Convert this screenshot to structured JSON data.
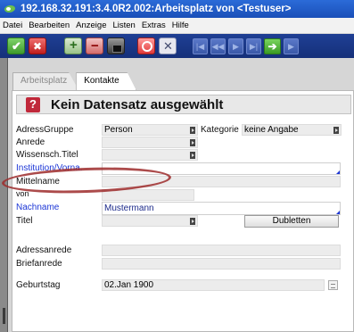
{
  "window": {
    "title": "192.168.32.191:3.4.0R2.002:Arbeitsplatz von <Testuser>"
  },
  "menu": [
    "Datei",
    "Bearbeiten",
    "Anzeige",
    "Listen",
    "Extras",
    "Hilfe"
  ],
  "toolbar": {
    "icons": [
      "confirm-icon",
      "cancel-icon",
      "new-record-icon",
      "delete-record-icon",
      "lock-icon",
      "search-icon",
      "clear-icon",
      "first-record-icon",
      "prev-record-icon",
      "next-record-icon",
      "last-record-icon",
      "goto-icon",
      "nav-extra-icon"
    ]
  },
  "tabs": [
    {
      "label": "Arbeitsplatz",
      "active": false
    },
    {
      "label": "Kontakte",
      "active": true
    }
  ],
  "header": {
    "title": "Kein Datensatz ausgewählt"
  },
  "form": {
    "adressgruppe": {
      "label": "AdressGruppe",
      "value": "Person"
    },
    "kategorie": {
      "label": "Kategorie",
      "value": "keine Angabe"
    },
    "anrede": {
      "label": "Anrede",
      "value": ""
    },
    "wissensch_titel": {
      "label": "Wissensch.Titel",
      "value": ""
    },
    "institution": {
      "label": "Institution/Vorna.",
      "value": ""
    },
    "mittelname": {
      "label": "Mittelname",
      "value": ""
    },
    "von": {
      "label": "von",
      "value": ""
    },
    "nachname": {
      "label": "Nachname",
      "value": "Mustermann"
    },
    "titel": {
      "label": "Titel",
      "value": ""
    },
    "dubletten": {
      "label": "Dubletten"
    },
    "adressanrede": {
      "label": "Adressanrede",
      "value": ""
    },
    "briefanrede": {
      "label": "Briefanrede",
      "value": ""
    },
    "geburtstag": {
      "label": "Geburtstag",
      "value": "02.Jan 1900"
    }
  },
  "colors": {
    "toolbar": "#1f3f94",
    "titlebar": "#2b6bd8",
    "required_label": "#1c36d6",
    "highlight": "#9e2b2b"
  }
}
